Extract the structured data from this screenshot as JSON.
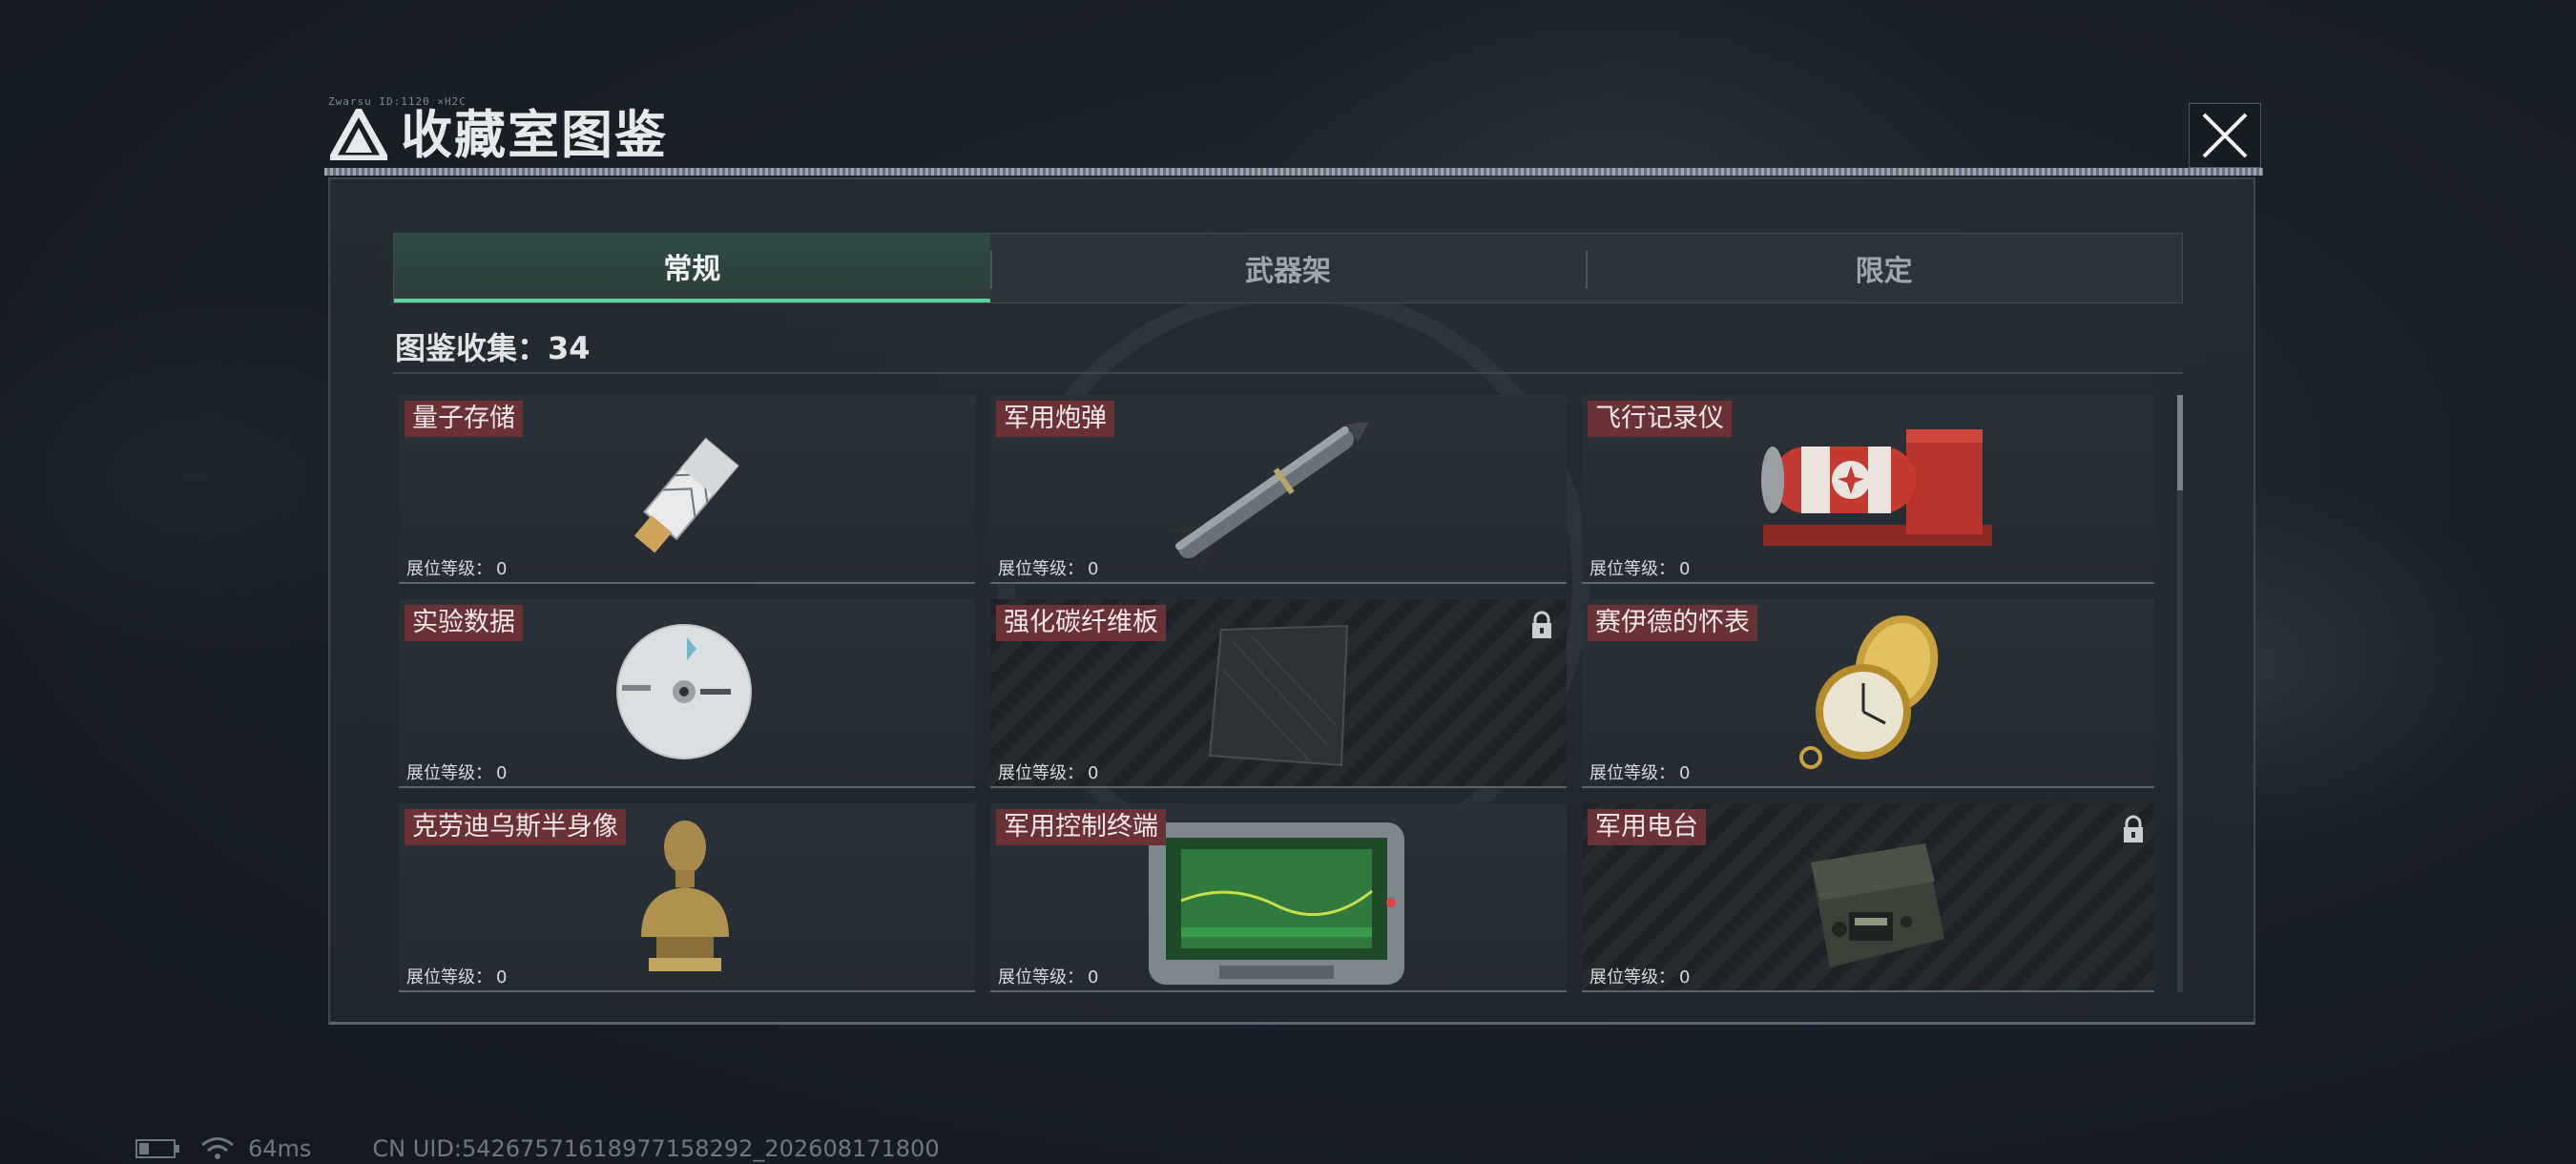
{
  "header": {
    "caption": "Zwarsu ID:1120 ×H2C",
    "title": "收藏室图鉴",
    "close_icon": "close-x-icon"
  },
  "tabs": [
    {
      "label": "常规",
      "active": true
    },
    {
      "label": "武器架",
      "active": false
    },
    {
      "label": "限定",
      "active": false
    }
  ],
  "collection": {
    "label": "图鉴收集：34"
  },
  "level_label": "展位等级：",
  "cards": [
    {
      "name": "量子存储",
      "level": "0",
      "locked": false,
      "icon": "usb-drive-icon"
    },
    {
      "name": "军用炮弹",
      "level": "0",
      "locked": false,
      "icon": "missile-icon"
    },
    {
      "name": "飞行记录仪",
      "level": "0",
      "locked": false,
      "icon": "flight-recorder-icon"
    },
    {
      "name": "实验数据",
      "level": "0",
      "locked": false,
      "icon": "disc-icon"
    },
    {
      "name": "强化碳纤维板",
      "level": "0",
      "locked": true,
      "icon": "carbon-plate-icon"
    },
    {
      "name": "赛伊德的怀表",
      "level": "0",
      "locked": false,
      "icon": "pocket-watch-icon"
    },
    {
      "name": "克劳迪乌斯半身像",
      "level": "0",
      "locked": false,
      "icon": "bust-statue-icon"
    },
    {
      "name": "军用控制终端",
      "level": "0",
      "locked": false,
      "icon": "control-terminal-icon"
    },
    {
      "name": "军用电台",
      "level": "0",
      "locked": true,
      "icon": "radio-icon"
    }
  ],
  "status": {
    "ping": "64ms",
    "uid": "CN UID:5426757161897715829​2_202608171800"
  },
  "colors": {
    "accent": "#58d49a",
    "card_title_bg": "#6b3236"
  }
}
